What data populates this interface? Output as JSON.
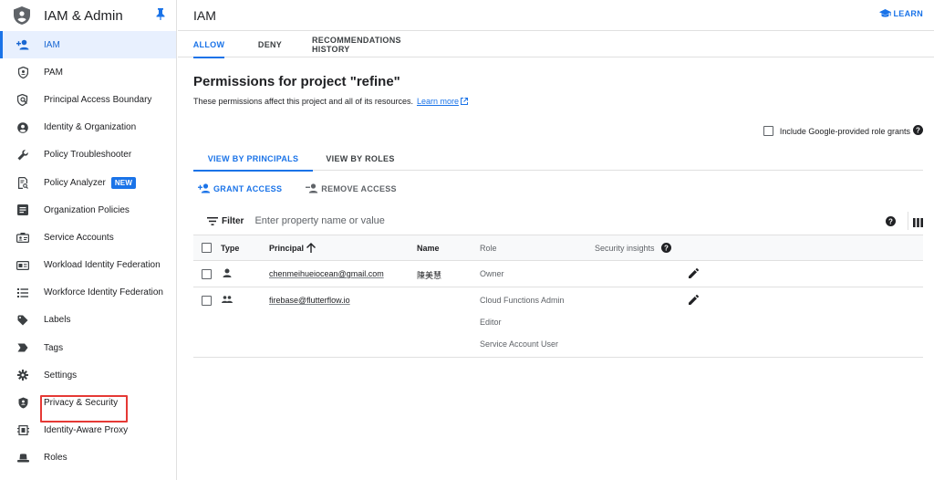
{
  "sidebar": {
    "title": "IAM & Admin",
    "items": [
      {
        "label": "IAM",
        "icon": "person-add-icon",
        "active": true
      },
      {
        "label": "PAM",
        "icon": "shield-outline-icon"
      },
      {
        "label": "Principal Access Boundary",
        "icon": "policy-icon"
      },
      {
        "label": "Identity & Organization",
        "icon": "account-circle-icon"
      },
      {
        "label": "Policy Troubleshooter",
        "icon": "wrench-icon"
      },
      {
        "label": "Policy Analyzer",
        "icon": "doc-search-icon",
        "badge": "NEW"
      },
      {
        "label": "Organization Policies",
        "icon": "article-icon"
      },
      {
        "label": "Service Accounts",
        "icon": "service-account-icon"
      },
      {
        "label": "Workload Identity Federation",
        "icon": "id-card-icon"
      },
      {
        "label": "Workforce Identity Federation",
        "icon": "list-icon"
      },
      {
        "label": "Labels",
        "icon": "label-icon"
      },
      {
        "label": "Tags",
        "icon": "tag-arrow-icon"
      },
      {
        "label": "Settings",
        "icon": "gear-icon"
      },
      {
        "label": "Privacy & Security",
        "icon": "privacy-shield-icon"
      },
      {
        "label": "Identity-Aware Proxy",
        "icon": "iap-icon"
      },
      {
        "label": "Roles",
        "icon": "hat-icon"
      }
    ]
  },
  "header": {
    "title": "IAM",
    "learn_label": "LEARN"
  },
  "tabs": [
    {
      "label": "ALLOW",
      "active": true
    },
    {
      "label": "DENY"
    },
    {
      "label": "RECOMMENDATIONS HISTORY"
    }
  ],
  "permissions": {
    "title": "Permissions for project \"refine\"",
    "description": "These permissions affect this project and all of its resources.",
    "learn_more": "Learn more",
    "include_label": "Include Google-provided role grants"
  },
  "view_tabs": [
    {
      "label": "VIEW BY PRINCIPALS",
      "active": true
    },
    {
      "label": "VIEW BY ROLES"
    }
  ],
  "actions": {
    "grant": "GRANT ACCESS",
    "remove": "REMOVE ACCESS"
  },
  "filter": {
    "label": "Filter",
    "placeholder": "Enter property name or value"
  },
  "table": {
    "columns": {
      "type": "Type",
      "principal": "Principal",
      "name": "Name",
      "role": "Role",
      "insights": "Security insights"
    },
    "rows": [
      {
        "type_icon": "person-icon",
        "principal": "chenmeihueiocean@gmail.com",
        "name": "陳美慧",
        "roles": [
          "Owner"
        ]
      },
      {
        "type_icon": "group-icon",
        "principal": "firebase@flutterflow.io",
        "name": "",
        "roles": [
          "Cloud Functions Admin",
          "Editor",
          "Service Account User"
        ]
      }
    ]
  },
  "colors": {
    "accent": "#1a73e8",
    "highlight": "#e53935"
  }
}
